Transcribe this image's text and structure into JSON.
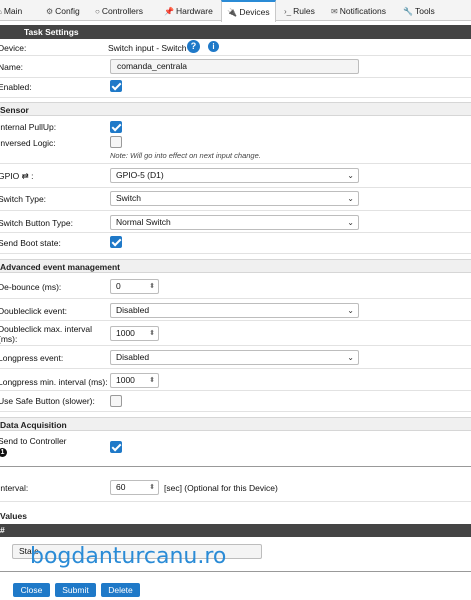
{
  "tabs": [
    {
      "icon": "⌂",
      "label": "Main"
    },
    {
      "icon": "⚙",
      "label": "Config"
    },
    {
      "icon": "○",
      "label": "Controllers"
    },
    {
      "icon": "📌",
      "label": "Hardware"
    },
    {
      "icon": "🔌",
      "label": "Devices"
    },
    {
      "icon": "›_",
      "label": "Rules"
    },
    {
      "icon": "✉",
      "label": "Notifications"
    },
    {
      "icon": "🔧",
      "label": "Tools"
    }
  ],
  "task_settings": {
    "header": "Task Settings",
    "device_label": "Device:",
    "device_value": "Switch input - Switch",
    "help_icon": "?",
    "info_icon": "i",
    "name_label": "Name:",
    "name_value": "comanda_centrala",
    "enabled_label": "Enabled:"
  },
  "sensor": {
    "header": "Sensor",
    "pullup_label": "Internal PullUp:",
    "inversed_label": "Inversed Logic:",
    "note": "Note: Will go into effect on next input change.",
    "gpio_label": "GPIO ⇄ :",
    "gpio_value": "GPIO-5 (D1)",
    "switch_type_label": "Switch Type:",
    "switch_type_value": "Switch",
    "switch_button_label": "Switch Button Type:",
    "switch_button_value": "Normal Switch",
    "boot_state_label": "Send Boot state:"
  },
  "advanced": {
    "header": "Advanced event management",
    "debounce_label": "De-bounce (ms):",
    "debounce_value": "0",
    "doubleclick_label": "Doubleclick event:",
    "doubleclick_value": "Disabled",
    "doubleclick_interval_label": "Doubleclick max. interval (ms):",
    "doubleclick_interval_value": "1000",
    "longpress_label": "Longpress event:",
    "longpress_value": "Disabled",
    "longpress_interval_label": "Longpress min. interval (ms):",
    "longpress_interval_value": "1000",
    "safe_button_label": "Use Safe Button (slower):"
  },
  "data_acquisition": {
    "header": "Data Acquisition",
    "send_label": "Send to Controller",
    "marker": "1",
    "interval_label": "Interval:",
    "interval_value": "60",
    "interval_suffix": "[sec] (Optional for this Device)"
  },
  "values": {
    "header": "Values",
    "col_header": "#",
    "value_name": "State"
  },
  "buttons": {
    "close": "Close",
    "submit": "Submit",
    "delete": "Delete"
  },
  "watermark": "bogdanturcanu.ro",
  "colors": {
    "accent": "#1f79c8",
    "header_dark": "#444444"
  }
}
